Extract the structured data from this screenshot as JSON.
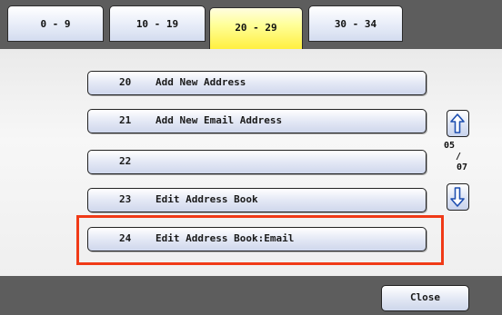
{
  "tabs": [
    {
      "label": "0 - 9",
      "active": false
    },
    {
      "label": "10 - 19",
      "active": false
    },
    {
      "label": "20 - 29",
      "active": true
    },
    {
      "label": "30 - 34",
      "active": false
    }
  ],
  "entries": [
    {
      "number": "20",
      "label": "Add New Address"
    },
    {
      "number": "21",
      "label": "Add New Email Address"
    },
    {
      "number": "22",
      "label": ""
    },
    {
      "number": "23",
      "label": "Edit Address Book"
    },
    {
      "number": "24",
      "label": "Edit Address Book:Email",
      "highlighted": true
    }
  ],
  "pagination": {
    "current": "05",
    "separator": "/",
    "total": "07",
    "up_icon": "arrow-up-icon",
    "down_icon": "arrow-down-icon"
  },
  "footer": {
    "close_label": "Close"
  },
  "colors": {
    "active_tab": "#ffff66",
    "highlight_border": "#f03a17",
    "bar_background": "#5d5d5d"
  }
}
